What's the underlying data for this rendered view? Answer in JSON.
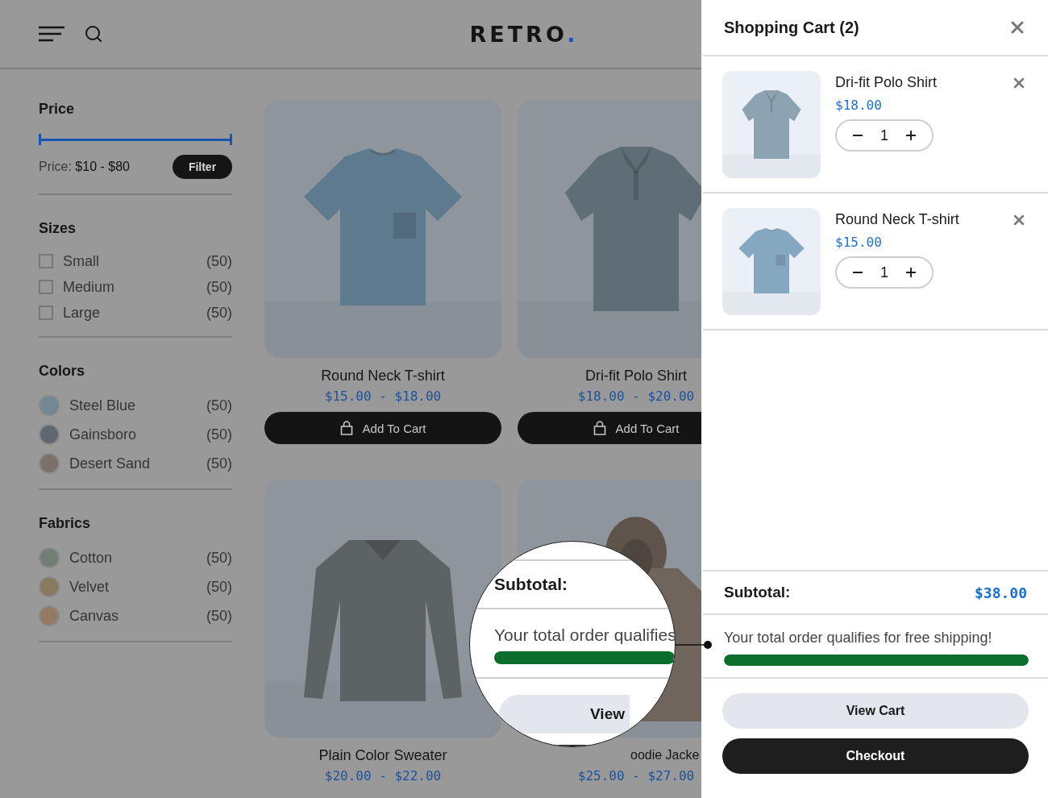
{
  "header": {
    "logo": {
      "text": "RETRO",
      "dot": "."
    }
  },
  "filters": {
    "price": {
      "title": "Price",
      "level": 1,
      "label": "Price:",
      "range": "$10 - $80",
      "button": "Filter"
    },
    "groups": [
      {
        "kind": "checkbox",
        "title": "Sizes",
        "items": [
          {
            "label": "Small",
            "count": "(50)",
            "checked": false
          },
          {
            "label": "Medium",
            "count": "(50)",
            "checked": false
          },
          {
            "label": "Large",
            "count": "(50)",
            "checked": false
          }
        ]
      },
      {
        "kind": "swatch",
        "title": "Colors",
        "items": [
          {
            "label": "Steel Blue",
            "count": "(50)",
            "color": "#728895"
          },
          {
            "label": "Gainsboro",
            "count": "(50)",
            "color": "#5f6870"
          },
          {
            "label": "Desert Sand",
            "count": "(50)",
            "color": "#7d7068"
          }
        ]
      },
      {
        "kind": "pattern",
        "title": "Fabrics",
        "items": [
          {
            "label": "Cotton",
            "count": "(50)",
            "color": "#6f7f74"
          },
          {
            "label": "Velvet",
            "count": "(50)",
            "color": "#8a7a55"
          },
          {
            "label": "Canvas",
            "count": "(50)",
            "color": "#9a7a5a"
          }
        ]
      }
    ]
  },
  "products": [
    {
      "title": "Round Neck T-shirt",
      "price": "$15.00 - $18.00",
      "button": "Add To Cart"
    },
    {
      "title": "Dri-fit Polo Shirt",
      "price": "$18.00 - $20.00",
      "button": "Add To Cart"
    },
    {
      "title": "Plain Color Sweater",
      "price": "$20.00 - $22.00"
    },
    {
      "title": "oodie Jacke",
      "price": "$25.00 - $27.00"
    }
  ],
  "cart": {
    "title": "Shopping Cart (2)",
    "items": [
      {
        "name": "Dri-fit Polo Shirt",
        "price": "$18.00",
        "quantity": "1"
      },
      {
        "name": "Round Neck T-shirt",
        "price": "$15.00",
        "quantity": "1"
      }
    ],
    "subtotal": {
      "label": "Subtotal:",
      "value": "$38.00"
    },
    "shipping": {
      "message": "Your total order qualifies for free shipping!",
      "level": 1
    },
    "buttons": [
      {
        "label": "View Cart",
        "kind": "secondary"
      },
      {
        "label": "Checkout",
        "kind": "primary"
      }
    ]
  },
  "magnifier": {
    "subtotal_label": "Subtotal:",
    "message": "Your total order qualifies",
    "level": 1,
    "button": "View"
  }
}
